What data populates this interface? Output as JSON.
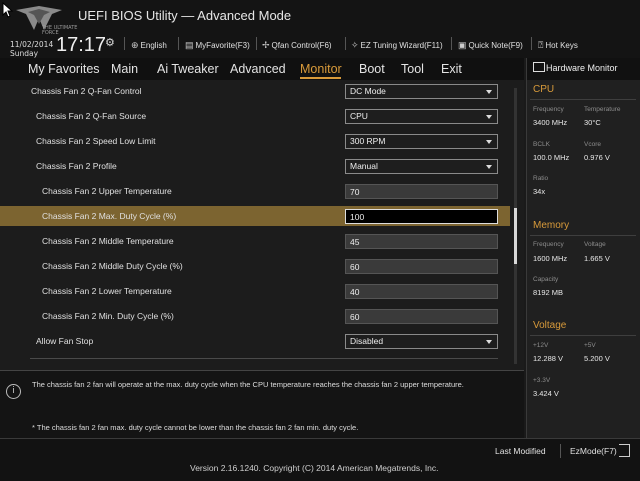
{
  "header": {
    "logo_text": "THE ULTIMATE FORCE",
    "title": "UEFI BIOS Utility — Advanced Mode",
    "date": "11/02/2014",
    "day": "Sunday",
    "time": "17:17",
    "items": [
      {
        "icon": "globe-icon",
        "label": "English"
      },
      {
        "icon": "favorite-icon",
        "label": "MyFavorite(F3)"
      },
      {
        "icon": "fan-icon",
        "label": "Qfan Control(F6)"
      },
      {
        "icon": "wizard-icon",
        "label": "EZ Tuning Wizard(F11)"
      },
      {
        "icon": "note-icon",
        "label": "Quick Note(F9)"
      },
      {
        "icon": "hotkeys-icon",
        "label": "Hot Keys"
      }
    ]
  },
  "menu": {
    "items": [
      "My Favorites",
      "Main",
      "Ai Tweaker",
      "Advanced",
      "Monitor",
      "Boot",
      "Tool",
      "Exit"
    ],
    "active": "Monitor"
  },
  "settings": [
    {
      "label": "Chassis Fan 2 Q-Fan Control",
      "type": "select",
      "value": "DC Mode"
    },
    {
      "label": "Chassis Fan 2 Q-Fan Source",
      "type": "select",
      "value": "CPU"
    },
    {
      "label": "Chassis Fan 2 Speed Low Limit",
      "type": "select",
      "value": "300 RPM"
    },
    {
      "label": "Chassis Fan 2 Profile",
      "type": "select",
      "value": "Manual"
    },
    {
      "label": "Chassis Fan 2 Upper Temperature",
      "type": "input",
      "value": "70"
    },
    {
      "label": "Chassis Fan 2 Max. Duty Cycle (%)",
      "type": "input",
      "value": "100",
      "selected": true
    },
    {
      "label": "Chassis Fan 2 Middle Temperature",
      "type": "input",
      "value": "45"
    },
    {
      "label": "Chassis Fan 2 Middle Duty Cycle (%)",
      "type": "input",
      "value": "60"
    },
    {
      "label": "Chassis Fan 2 Lower Temperature",
      "type": "input",
      "value": "40"
    },
    {
      "label": "Chassis Fan 2 Min. Duty Cycle (%)",
      "type": "input",
      "value": "60"
    },
    {
      "label": "Allow Fan Stop",
      "type": "select",
      "value": "Disabled"
    }
  ],
  "info": {
    "line1": "The chassis fan 2 fan will operate at the max. duty cycle when the CPU temperature reaches the chassis fan 2 upper temperature.",
    "line2": "* The chassis fan 2 fan max. duty cycle cannot be lower than the chassis fan 2 fan min. duty cycle."
  },
  "hardware_monitor": {
    "title": "Hardware Monitor",
    "cpu": {
      "section": "CPU",
      "frequency_label": "Frequency",
      "frequency": "3400 MHz",
      "temperature_label": "Temperature",
      "temperature": "30°C",
      "bclk_label": "BCLK",
      "bclk": "100.0 MHz",
      "vcore_label": "Vcore",
      "vcore": "0.976 V",
      "ratio_label": "Ratio",
      "ratio": "34x"
    },
    "memory": {
      "section": "Memory",
      "frequency_label": "Frequency",
      "frequency": "1600 MHz",
      "voltage_label": "Voltage",
      "voltage": "1.665 V",
      "capacity_label": "Capacity",
      "capacity": "8192 MB"
    },
    "voltage": {
      "section": "Voltage",
      "v12_label": "+12V",
      "v12": "12.288 V",
      "v5_label": "+5V",
      "v5": "5.200 V",
      "v33_label": "+3.3V",
      "v33": "3.424 V"
    }
  },
  "footer": {
    "last_modified": "Last Modified",
    "ezmode": "EzMode(F7)",
    "copyright": "Version 2.16.1240. Copyright (C) 2014 American Megatrends, Inc."
  },
  "colors": {
    "accent": "#d89a3a",
    "highlight_row": "#7c6430"
  }
}
